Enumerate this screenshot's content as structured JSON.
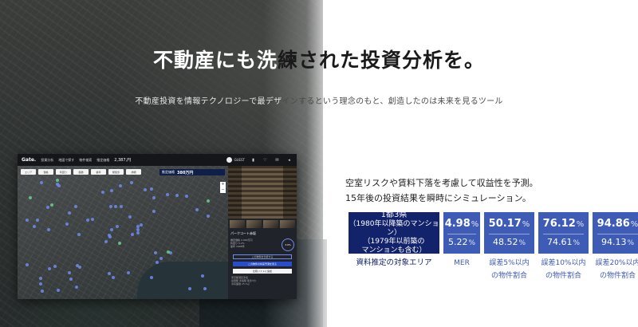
{
  "headline": {
    "part_on_image": "不動産にも洗",
    "rest": "練された投資分析を。"
  },
  "subline": {
    "part_on_image": "不動産投資を情報テクノロジーで最デザ",
    "rest": "インするという理念のもと、創造したのは未来を見るツール"
  },
  "app": {
    "logo": "Gate.",
    "nav": [
      "投資分析",
      "地図で探す",
      "物件検索"
    ],
    "price_label": "推定価格",
    "price_value": "2,387,円",
    "guest": "GUEST",
    "top_icons": [
      "chart-icon",
      "save-icon",
      "chat-icon",
      "share-icon"
    ],
    "filters": [
      "エリア",
      "価格",
      "利回り",
      "面積",
      "築年",
      "駅徒歩",
      "詳細"
    ],
    "map_badge": {
      "label": "推定価格",
      "value": "380万円"
    },
    "zoom": [
      "+",
      "−"
    ],
    "panel": {
      "property_name": "パークコート赤坂",
      "info_lines": [
        "推定価格 2,000万円",
        "利回り 5.2%",
        "築年 1998年"
      ],
      "score": "3.9%",
      "buttons": [
        "この物件を分析する",
        "この物件の将来予測を見る",
        "比較リストに追加"
      ],
      "detail_lines": [
        "東京都港区赤坂",
        "最寄駅 赤坂駅 徒歩3分",
        "専有面積 25.5㎡"
      ]
    }
  },
  "description": {
    "line1": "空室リスクや賃料下落を考慮して収益性を予測。",
    "line2": "15年後の投資結果を瞬時にシミュレーション。"
  },
  "stats": {
    "target": {
      "title": "1都3県",
      "sub1": "（1980年以降築のマンション）",
      "sub2": "（1979年以前築の",
      "sub3": "マンションも含む）",
      "label": "資料推定の対象エリア"
    },
    "mer": {
      "top": "4.98",
      "bottom": "5.22",
      "unit": "%",
      "label": "MER"
    },
    "within5": {
      "top": "50.17",
      "bottom": "48.52",
      "unit": "%",
      "label_1": "誤差5%以内",
      "label_2": "の物件割合"
    },
    "within10": {
      "top": "76.12",
      "bottom": "74.61",
      "unit": "%",
      "label_1": "誤差10%以内",
      "label_2": "の物件割合"
    },
    "within20": {
      "top": "94.86",
      "bottom": "94.13",
      "unit": "%",
      "label_1": "誤差20%以内",
      "label_2": "の物件割合"
    }
  },
  "colors": {
    "navy": "#12226b",
    "blue": "#3e5bb6"
  }
}
